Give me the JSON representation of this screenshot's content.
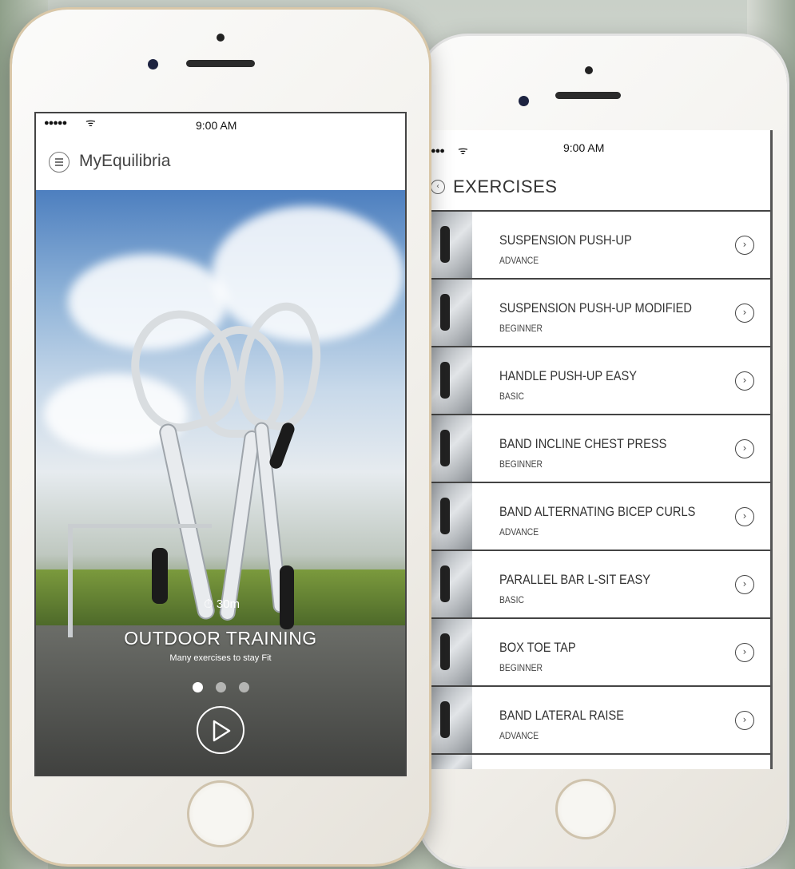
{
  "left_phone": {
    "status": {
      "time": "9:00 AM"
    },
    "header": {
      "app_title": "MyEquilibria"
    },
    "hero": {
      "timer": "30m",
      "title": "OUTDOOR TRAINING",
      "subtitle": "Many exercises to stay Fit",
      "page_count": 3,
      "active_page": 1
    }
  },
  "right_phone": {
    "status": {
      "time": "9:00 AM"
    },
    "header": {
      "title": "EXERCISES"
    },
    "exercises": [
      {
        "name": "SUSPENSION PUSH-UP",
        "level": "ADVANCE"
      },
      {
        "name": "SUSPENSION PUSH-UP MODIFIED",
        "level": "BEGINNER"
      },
      {
        "name": "HANDLE PUSH-UP EASY",
        "level": "BASIC"
      },
      {
        "name": "BAND INCLINE CHEST PRESS",
        "level": "BEGINNER"
      },
      {
        "name": "BAND ALTERNATING BICEP CURLS",
        "level": "ADVANCE"
      },
      {
        "name": "PARALLEL BAR L-SIT EASY",
        "level": "BASIC"
      },
      {
        "name": "BOX TOE TAP",
        "level": "BEGINNER"
      },
      {
        "name": "BAND LATERAL RAISE",
        "level": "ADVANCE"
      }
    ]
  },
  "icons": {
    "menu": "menu-icon",
    "back": "back-icon",
    "play": "play-icon",
    "chevron": "chevron-right-icon",
    "timer": "stopwatch-icon"
  }
}
